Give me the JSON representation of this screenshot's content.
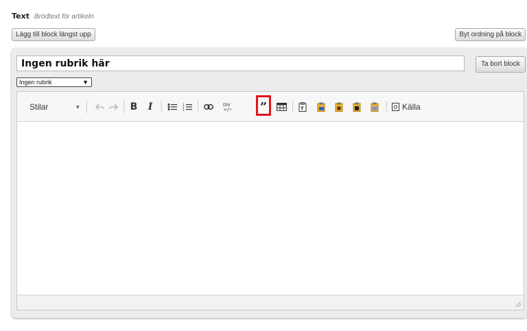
{
  "field": {
    "label": "Text",
    "description": "Brödtext för artikeln"
  },
  "buttons": {
    "add_block_top": "Lägg till block längst upp",
    "reorder_blocks": "Byt ordning på block",
    "remove_block": "Ta bort block"
  },
  "block": {
    "heading_value": "Ingen rubrik här",
    "heading_select": "Ingen rubrik"
  },
  "toolbar": {
    "styles_label": "Stilar",
    "source_label": "Källa",
    "icons": [
      "undo-icon",
      "redo-icon",
      "bold-icon",
      "italic-icon",
      "bulleted-list-icon",
      "numbered-list-icon",
      "link-icon",
      "div-icon",
      "blockquote-icon",
      "table-icon",
      "paste-text-icon",
      "paste-word-icon",
      "image-icon",
      "flash-icon",
      "special-icon",
      "source-icon"
    ],
    "highlighted_button": "blockquote-icon",
    "highlight_color": "#e2151b"
  }
}
